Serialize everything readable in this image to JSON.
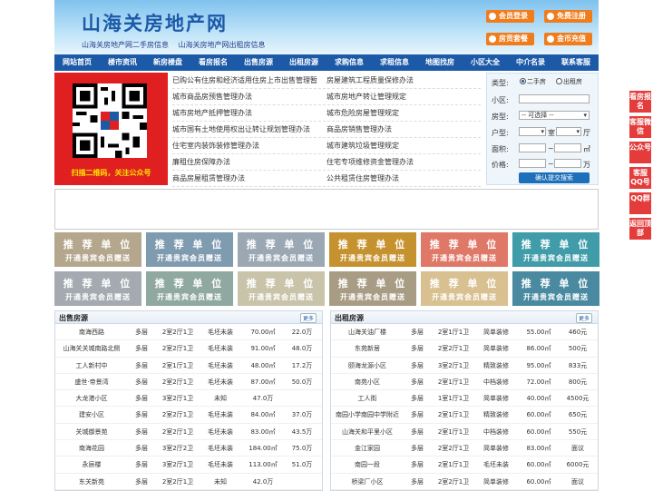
{
  "header": {
    "logo": "山海关房地产网",
    "sub_links": [
      "山海关房地产网二手房信息",
      "山海关房地产网出租房信息"
    ],
    "buttons": [
      "会员登录",
      "免费注册",
      "房贡套餐",
      "金币充值"
    ]
  },
  "nav": [
    "网站首页",
    "楼市资讯",
    "新房楼盘",
    "看房报名",
    "出售房源",
    "出租房源",
    "求购信息",
    "求租信息",
    "地图找房",
    "小区大全",
    "中介名录",
    "联系客服"
  ],
  "qr": {
    "caption": "扫描二维码，关注公众号"
  },
  "links": [
    [
      "已购公有住房和经济适用住房上市出售管理暂",
      "房屋建筑工程质量保修办法"
    ],
    [
      "城市商品房预售管理办法",
      "城市房地产转让管理规定"
    ],
    [
      "城市房地产抵押管理办法",
      "城市危险房屋管理规定"
    ],
    [
      "城市国有土地使用权出让转让规划管理办法",
      "商品房销售管理办法"
    ],
    [
      "住宅室内装饰装修管理办法",
      "城市建筑垃圾管理规定"
    ],
    [
      "廉租住房保障办法",
      "住宅专项维修资金管理办法"
    ],
    [
      "商品房屋租赁管理办法",
      "公共租赁住房管理办法"
    ]
  ],
  "search": {
    "type_label": "类型:",
    "radio1": "二手房",
    "radio2": "出租房",
    "area_label": "小区:",
    "house_label": "房型:",
    "house_select": "-- 可选择 --",
    "room_label": "户型:",
    "room_unit1": "室",
    "room_unit2": "厅",
    "size_label": "面积:",
    "size_unit": "㎡",
    "price_label": "价格:",
    "price_unit": "万",
    "submit": "确认提交搜索"
  },
  "recommend": {
    "line1": "推 荐 单 位",
    "line2": "开通贵宾会员赠送",
    "colors": [
      "#b5a78d",
      "#7f9bb0",
      "#9ba8b4",
      "#c6922f",
      "#e07868",
      "#3f9ca8",
      "#a4aab0",
      "#8fa8a0",
      "#c9c3aa",
      "#a89c84",
      "#d8c090",
      "#4a8aa0"
    ]
  },
  "sale": {
    "title": "出售房源",
    "more": "更多",
    "rows": [
      [
        "南海西路",
        "多层",
        "2室2厅1卫",
        "毛坯未装",
        "70.00㎡",
        "22.0万"
      ],
      [
        "山海关关城南路北侧",
        "多层",
        "2室2厅1卫",
        "毛坯未装",
        "91.00㎡",
        "48.0万"
      ],
      [
        "工人新村中",
        "多层",
        "2室1厅1卫",
        "毛坯未装",
        "48.00㎡",
        "17.2万"
      ],
      [
        "盛世·帝景湾",
        "多层",
        "2室2厅1卫",
        "毛坯未装",
        "87.00㎡",
        "50.0万"
      ],
      [
        "大龙港小区",
        "多层",
        "3室2厅1卫",
        "未知",
        "47.0万",
        ""
      ],
      [
        "建安小区",
        "多层",
        "2室2厅1卫",
        "毛坯未装",
        "84.00㎡",
        "37.0万"
      ],
      [
        "关城御景苑",
        "多层",
        "2室2厅1卫",
        "毛坯未装",
        "83.00㎡",
        "43.5万"
      ],
      [
        "南海花园",
        "多层",
        "3室2厅2卫",
        "毛坯未装",
        "184.00㎡",
        "75.0万"
      ],
      [
        "永辰楼",
        "多层",
        "3室2厅1卫",
        "毛坯未装",
        "113.00㎡",
        "51.0万"
      ],
      [
        "东关新苑",
        "多层",
        "2室2厅1卫",
        "未知",
        "42.0万",
        ""
      ]
    ]
  },
  "rent": {
    "title": "出租房源",
    "more": "更多",
    "rows": [
      [
        "山海关油厂楼",
        "多层",
        "2室1厅1卫",
        "简单装修",
        "55.00㎡",
        "460元"
      ],
      [
        "东苑新居",
        "多层",
        "2室2厅1卫",
        "简单装修",
        "86.00㎡",
        "500元"
      ],
      [
        "颐海龙源小区",
        "多层",
        "3室2厅1卫",
        "精致装修",
        "95.00㎡",
        "833元"
      ],
      [
        "南苑小区",
        "多层",
        "2室1厅1卫",
        "中档装修",
        "72.00㎡",
        "800元"
      ],
      [
        "工人街",
        "多层",
        "1室1厅1卫",
        "简单装修",
        "40.00㎡",
        "4500元"
      ],
      [
        "南园小学南园中学附近",
        "多层",
        "2室1厅1卫",
        "精致装修",
        "60.00㎡",
        "650元"
      ],
      [
        "山海关和平里小区",
        "多层",
        "2室1厅1卫",
        "中档装修",
        "60.00㎡",
        "550元"
      ],
      [
        "金江家园",
        "多层",
        "2室2厅1卫",
        "简单装修",
        "83.00㎡",
        "面议"
      ],
      [
        "南园一段",
        "多层",
        "2室1厅1卫",
        "毛坯未装",
        "60.00㎡",
        "6000元"
      ],
      [
        "桥梁厂小区",
        "多层",
        "2室2厅1卫",
        "简单装修",
        "60.00㎡",
        "面议"
      ]
    ]
  },
  "side": [
    "看房报名",
    "客服微信",
    "公众号",
    "客服QQ号",
    "QQ群",
    "返回顶部"
  ],
  "colors": {
    "accent": "#1c5aa8",
    "orange": "#f07c1c",
    "red": "#e43b3b"
  }
}
